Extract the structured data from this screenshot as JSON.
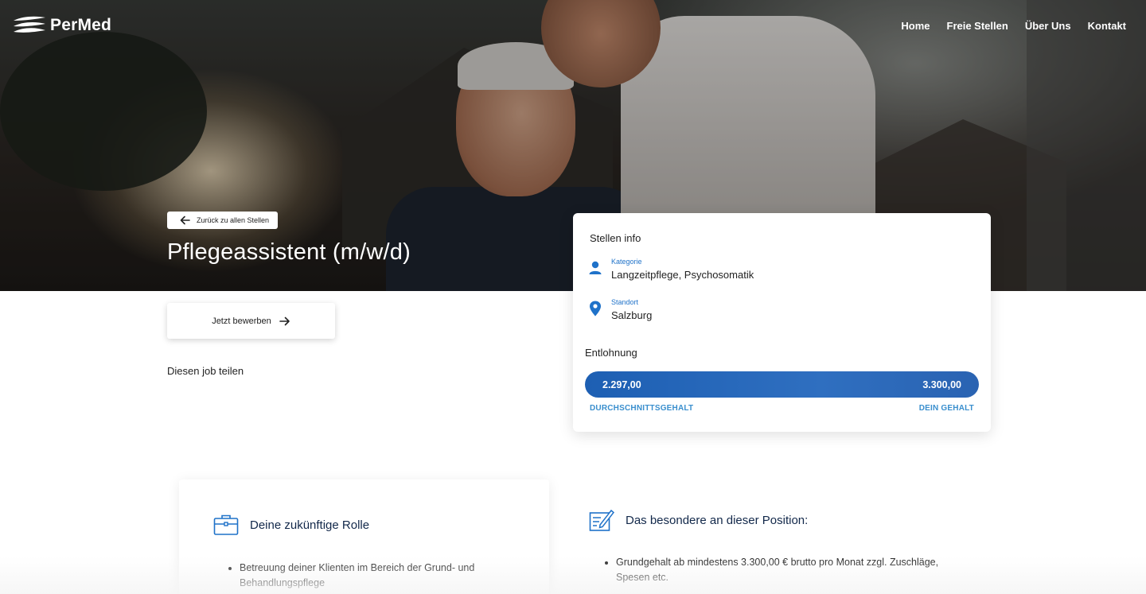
{
  "brand": {
    "name": "PerMed"
  },
  "nav": {
    "items": [
      "Home",
      "Freie Stellen",
      "Über Uns",
      "Kontakt"
    ]
  },
  "hero": {
    "back_label": "Zurück zu allen Stellen",
    "job_title": "Pflegeassistent (m/w/d)"
  },
  "actions": {
    "apply_label": "Jetzt bewerben",
    "share_label": "Diesen job teilen"
  },
  "info_card": {
    "title": "Stellen info",
    "category_label": "Kategorie",
    "category_value": "Langzeitpflege, Psychosomatik",
    "location_label": "Standort",
    "location_value": "Salzburg",
    "salary_heading": "Entlohnung",
    "salary_min": "2.297,00",
    "salary_max": "3.300,00",
    "salary_min_caption": "DURCHSCHNITTSGEHALT",
    "salary_max_caption": "DEIN GEHALT"
  },
  "role": {
    "title": "Deine zukünftige Rolle",
    "items": [
      "Betreuung deiner Klienten im Bereich der Grund- und Behandlungspflege"
    ]
  },
  "special": {
    "title": "Das besondere an dieser Position:",
    "items": [
      "Grundgehalt ab mindestens 3.300,00 € brutto pro Monat zzgl. Zuschläge, Spesen etc."
    ]
  },
  "colors": {
    "accent": "#1f72c9",
    "salary_bar": "#2a63b2",
    "heading_navy": "#12284a"
  }
}
